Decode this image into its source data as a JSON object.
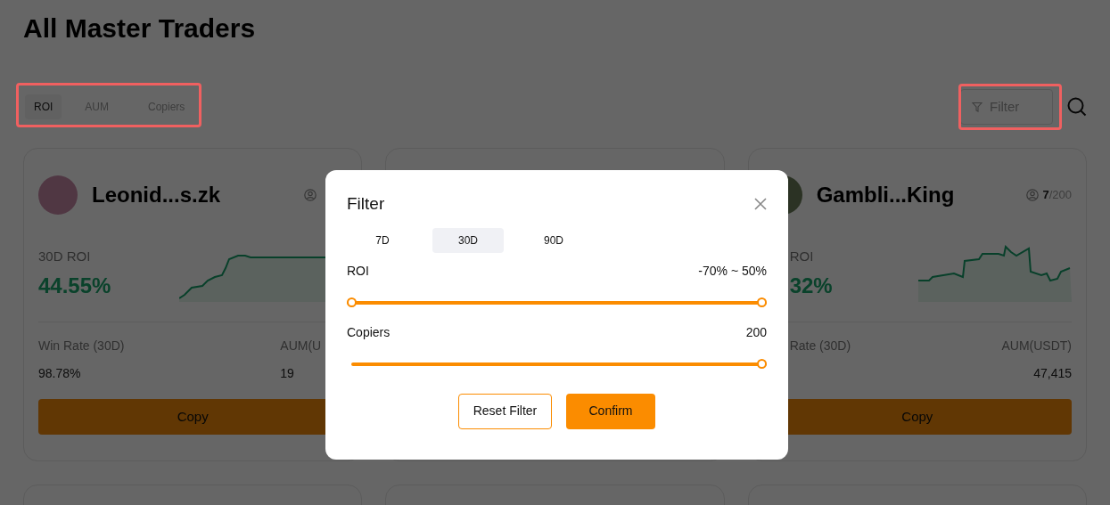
{
  "title": "All Master Traders",
  "sort_tabs": [
    {
      "label": "ROI",
      "selected": true
    },
    {
      "label": "AUM",
      "selected": false
    },
    {
      "label": "Copiers",
      "selected": false
    }
  ],
  "filter_button": {
    "label": "Filter"
  },
  "cards": [
    {
      "kind": "trader",
      "name": "Leonid...s.zk",
      "roi_label": "30D ROI",
      "roi_value": "44.55%",
      "win_rate_label": "Win Rate (30D)",
      "win_rate": "98.78%",
      "aum_label": "AUM(U",
      "aum": "19",
      "copy_label": "Copy"
    },
    {
      "kind": "blank"
    },
    {
      "kind": "trader",
      "name": "Gambli...King",
      "copiers": "**7**/200",
      "roi_label": "ROI",
      "roi_value": "32%",
      "win_rate_label": "Rate (30D)",
      "aum_label": "AUM(USDT)",
      "aum": "47,415",
      "copy_label": "Copy"
    },
    {
      "kind": "blank"
    },
    {
      "kind": "blank"
    },
    {
      "kind": "blank"
    }
  ],
  "modal": {
    "title": "Filter",
    "periods": [
      {
        "label": "7D",
        "selected": false
      },
      {
        "label": "30D",
        "selected": true
      },
      {
        "label": "90D",
        "selected": false
      }
    ],
    "ranges": [
      {
        "kind": "range",
        "label": "ROI",
        "reading": "-70% ~ 50%",
        "level": 1
      },
      {
        "kind": "single",
        "label": "Copiers",
        "reading": "200",
        "level": 1
      }
    ],
    "buttons": [
      {
        "kind": "outline",
        "label": "Reset Filter"
      },
      {
        "kind": "primary",
        "label": "Confirm"
      }
    ]
  }
}
